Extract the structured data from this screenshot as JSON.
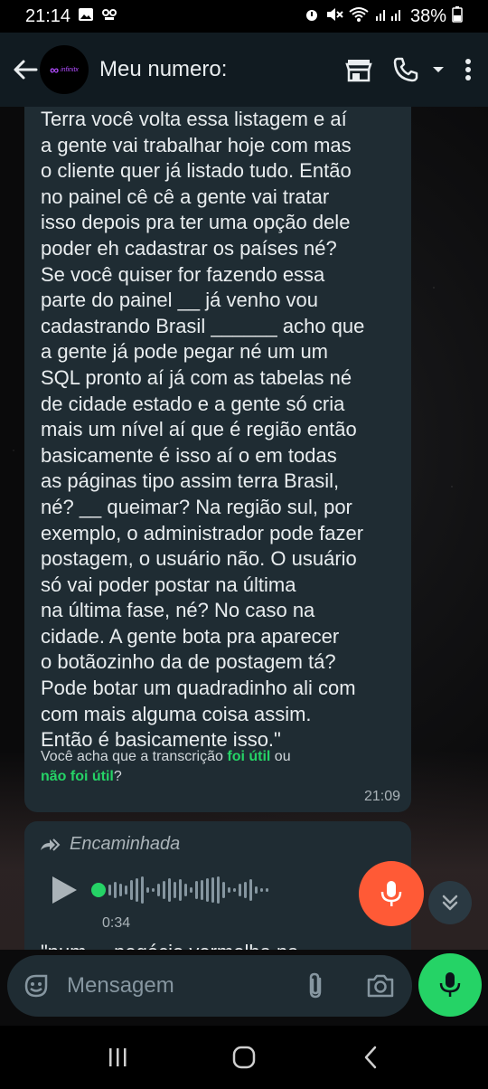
{
  "status_bar": {
    "time": "21:14",
    "battery": "38%"
  },
  "header": {
    "avatar_symbol": "∞",
    "avatar_brand": "infinitx",
    "title": "Meu numero:"
  },
  "message": {
    "text": "Terra você volta essa listagem e aí\na gente vai trabalhar hoje com mas\no cliente quer já listado tudo. Então\nno painel cê cê a gente vai tratar\nisso depois pra ter uma opção dele\npoder eh cadastrar os países né?\nSe você quiser for fazendo essa\nparte do painel __ já venho vou\ncadastrando Brasil ______ acho que\na gente já pode pegar né um um\nSQL pronto aí já com as tabelas né\nde cidade estado e a gente só cria\nmais um nível aí que é região então\nbasicamente é isso aí o em todas\nas páginas tipo assim terra Brasil,\nné? __ queimar? Na região sul, por\nexemplo, o administrador pode fazer\npostagem, o usuário não. O usuário\nsó vai poder postar na última\nna última fase, né? No caso na\ncidade. A gente bota pra aparecer\no botãozinho da de postagem tá?\nPode botar um quadradinho ali com\ncom mais alguma coisa assim.\nEntão é basicamente isso.\"",
    "feedback_prefix": "Você acha que a transcrição ",
    "feedback_useful": "foi útil",
    "feedback_or": " ou",
    "feedback_not_useful": "não foi útil",
    "feedback_suffix": "?",
    "time": "21:09"
  },
  "audio_message": {
    "forwarded_label": "Encaminhada",
    "duration": "0:34",
    "next_text": "\"num ... negócio vermelha na"
  },
  "composer": {
    "placeholder": "Mensagem"
  },
  "colors": {
    "accent_green": "#25d366",
    "record_orange": "#ff5a36",
    "bubble": "#1f2c33",
    "header": "#111b21"
  }
}
